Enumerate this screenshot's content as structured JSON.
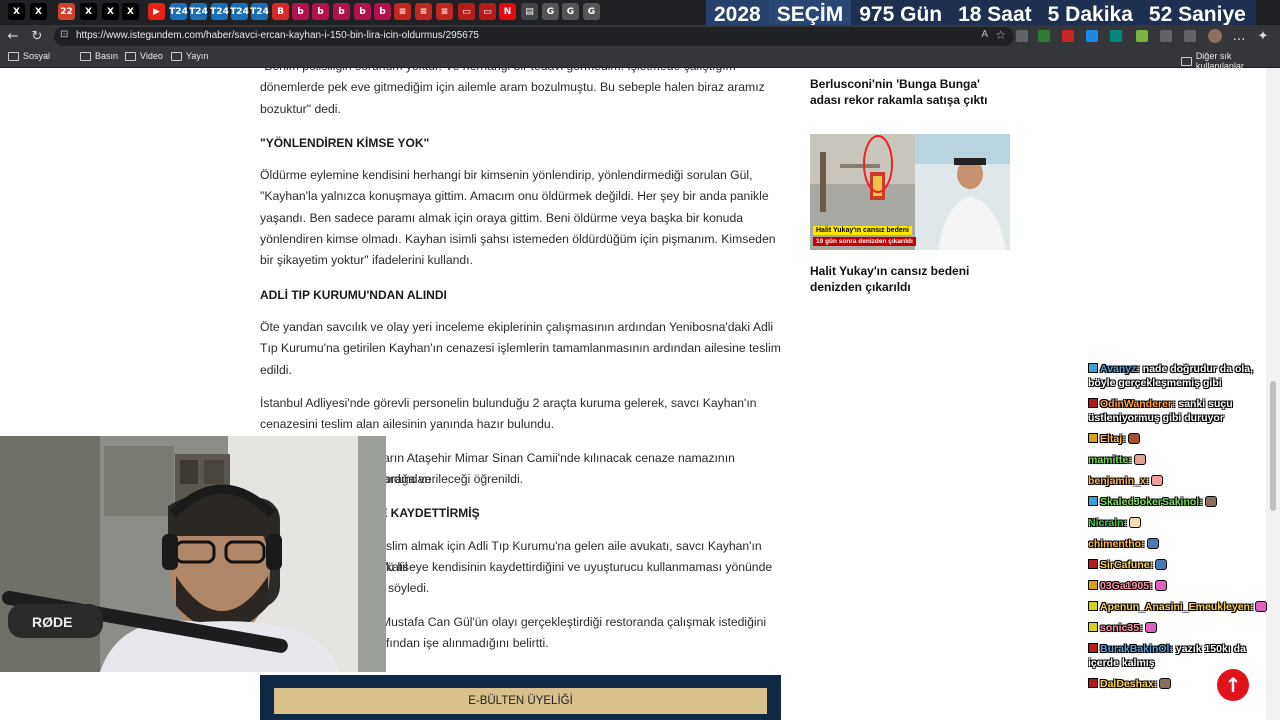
{
  "browser": {
    "url": "https://www.istegundem.com/haber/savci-ercan-kayhan-i-150-bin-lira-icin-oldurmus/295675",
    "bookmarks": [
      "Sosyal",
      "Basın",
      "Video",
      "Yayın"
    ],
    "other_bookmarks": "Diğer sık kullanılanlar",
    "tabs": [
      {
        "glyph": "X",
        "color": "#000000"
      },
      {
        "glyph": "X",
        "color": "#000000"
      },
      {
        "glyph": "22",
        "color": "#d0402f"
      },
      {
        "glyph": "X",
        "color": "#000000"
      },
      {
        "glyph": "X",
        "color": "#000000"
      },
      {
        "glyph": "X",
        "color": "#000000"
      },
      {
        "glyph": "▶",
        "color": "#e62117"
      },
      {
        "glyph": "T24",
        "color": "#1a6fb5"
      },
      {
        "glyph": "T24",
        "color": "#1a6fb5"
      },
      {
        "glyph": "T24",
        "color": "#1a6fb5"
      },
      {
        "glyph": "T24",
        "color": "#1a6fb5"
      },
      {
        "glyph": "T24",
        "color": "#1a6fb5"
      },
      {
        "glyph": "B",
        "color": "#d62a2a"
      },
      {
        "glyph": "b",
        "color": "#b0124e"
      },
      {
        "glyph": "b",
        "color": "#b0124e"
      },
      {
        "glyph": "b",
        "color": "#b0124e"
      },
      {
        "glyph": "b",
        "color": "#b0124e"
      },
      {
        "glyph": "b",
        "color": "#b0124e"
      },
      {
        "glyph": "≡",
        "color": "#c0271f"
      },
      {
        "glyph": "≡",
        "color": "#c0271f"
      },
      {
        "glyph": "≡",
        "color": "#c0271f"
      },
      {
        "glyph": "▭",
        "color": "#b71c1c"
      },
      {
        "glyph": "▭",
        "color": "#b71c1c"
      },
      {
        "glyph": "N",
        "color": "#e50914"
      },
      {
        "glyph": "▤",
        "color": "#444444"
      },
      {
        "glyph": "G",
        "color": "#555555"
      },
      {
        "glyph": "G",
        "color": "#555555"
      },
      {
        "glyph": "G",
        "color": "#555555"
      }
    ]
  },
  "countdown": {
    "year": "2028",
    "label": "SEÇİM",
    "days": "975 Gün",
    "hours": "18 Saat",
    "minutes": "5 Dakika",
    "seconds": "52 Saniye"
  },
  "article": {
    "p0": "\"Benim polisiliğin sorunum yoktur. Ve hernangi bir tedavi görmedim. İşletmede çalıştığım dönemlerde pek eve gitmediğim için ailemle aram bozulmuştu. Bu sebeple halen biraz aramız bozuktur\" dedi.",
    "h1": "\"YÖNLENDİREN KİMSE YOK\"",
    "p1": "Öldürme eylemine kendisini herhangi bir kimsenin yönlendirip, yönlendirmediği sorulan Gül, \"Kayhan'la yalnızca konuşmaya gittim. Amacım onu öldürmek değildi. Her şey bir anda panikle yaşandı. Ben sadece paramı almak için oraya gittim. Beni öldürme veya başka bir konuda yönlendiren kimse olmadı. Kayhan isimli şahsı istemeden öldürdüğüm için pişmanım. Kimseden bir şikayetim yoktur\" ifadelerini kullandı.",
    "h2": "ADLİ TIP KURUMU'NDAN ALINDI",
    "p2": "Öte yandan savcılık ve olay yeri inceleme ekiplerinin çalışmasının ardından Yenibosna'daki Adli Tıp Kurumu'na getirilen Kayhan'ın cenazesi işlemlerin tamamlanmasının ardından ailesine teslim edildi.",
    "p3": "İstanbul Adliyesi'nde görevli personelin bulunduğu 2 araçta kuruma gelerek, savcı Kayhan'ın cenazesini teslim alan ailesinin yanında hazır bulundu.",
    "p4a": "arın Ataşehir Mimar Sinan Camii'nde kılınacak cenaze namazının ardından",
    "p4b": "toprağa verileceği öğrenildi.",
    "h3": "TE KAYDETTİRMİŞ",
    "p5a": "slim almak için Adli Tıp Kurumu'na gelen aile avukatı, savcı Kayhan'ın katil",
    "p5b": "'ü liseye kendisinin kaydettirdiğini ve uyuşturucu kullanmaması yönünde",
    "p5c": "söyledi.",
    "p6a": "Mustafa Can Gül'ün olayı gerçekleştirdiği restoranda çalışmak istediğini",
    "p6b": "fından işe alınmadığını belirtti.",
    "newsletter": "E-BÜLTEN ÜYELİĞİ"
  },
  "sidebar": {
    "item1_title": "Berlusconi'nin 'Bunga Bunga' adası rekor rakamla satışa çıktı",
    "thumb_caption_1": "Halit Yukay'ın cansız bedeni",
    "thumb_caption_2": "19 gün sonra denizden çıkarıldı",
    "item2_title": "Halit Yukay'ın cansız bedeni denizden çıkarıldı"
  },
  "chat": [
    {
      "user": "Avanyz:",
      "msg": "nade doğrudur da ola, böyle gerçekleşmemiş gibi",
      "color": "#5b9bd5",
      "badge": "#3aa0d8"
    },
    {
      "user": "OdinWanderer:",
      "msg": "sanki suçu üstleniyormuş gibi duruyor",
      "color": "#ff9f43",
      "badge": "#b31b1b"
    },
    {
      "user": "Eltaj:",
      "msg": "",
      "color": "#ffb84d",
      "badge": "#d4a017",
      "emote": "#a0522d"
    },
    {
      "user": "mamitte:",
      "msg": "",
      "color": "#7ed957",
      "badge": "",
      "emote": "#e8a090"
    },
    {
      "user": "benjamin_x:",
      "msg": "",
      "color": "#ffb347",
      "badge": "",
      "emote": "#f4a0a0"
    },
    {
      "user": "SkaledJokerSakinol:",
      "msg": "",
      "color": "#7ed957",
      "badge": "#3aa0d8",
      "emote": "#8b6f5e"
    },
    {
      "user": "Nicrain:",
      "msg": "",
      "color": "#3cd03c",
      "badge": "",
      "emote": "#f5deb3"
    },
    {
      "user": "chimentho:",
      "msg": "",
      "color": "#ffb347",
      "badge": "",
      "emote": "#4a7ab5"
    },
    {
      "user": "SirCafune:",
      "msg": "",
      "color": "#ffd24d",
      "badge": "#b31b1b",
      "emote": "#4a7ab5"
    },
    {
      "user": "03Ga1905:",
      "msg": "",
      "color": "#ff8fa3",
      "badge": "#d4a017",
      "emote": "#e060c0"
    },
    {
      "user": "Apenun_Anasini_Emeukleyen:",
      "msg": "",
      "color": "#ffd24d",
      "badge": "#d4d417",
      "emote": "#e060c0"
    },
    {
      "user": "sonic35:",
      "msg": "",
      "color": "#ff8fa3",
      "badge": "#d4d417",
      "emote": "#e060c0"
    },
    {
      "user": "BurakBakinOl:",
      "msg": "yazık 150kı da içerde kalmış",
      "color": "#5b9bd5",
      "badge": "#b31b1b"
    },
    {
      "user": "DalDeshax:",
      "msg": "",
      "color": "#ffd24d",
      "badge": "#b31b1b",
      "emote": "#8b6f5e"
    }
  ],
  "webcam": {
    "mic_brand": "RØDE"
  }
}
